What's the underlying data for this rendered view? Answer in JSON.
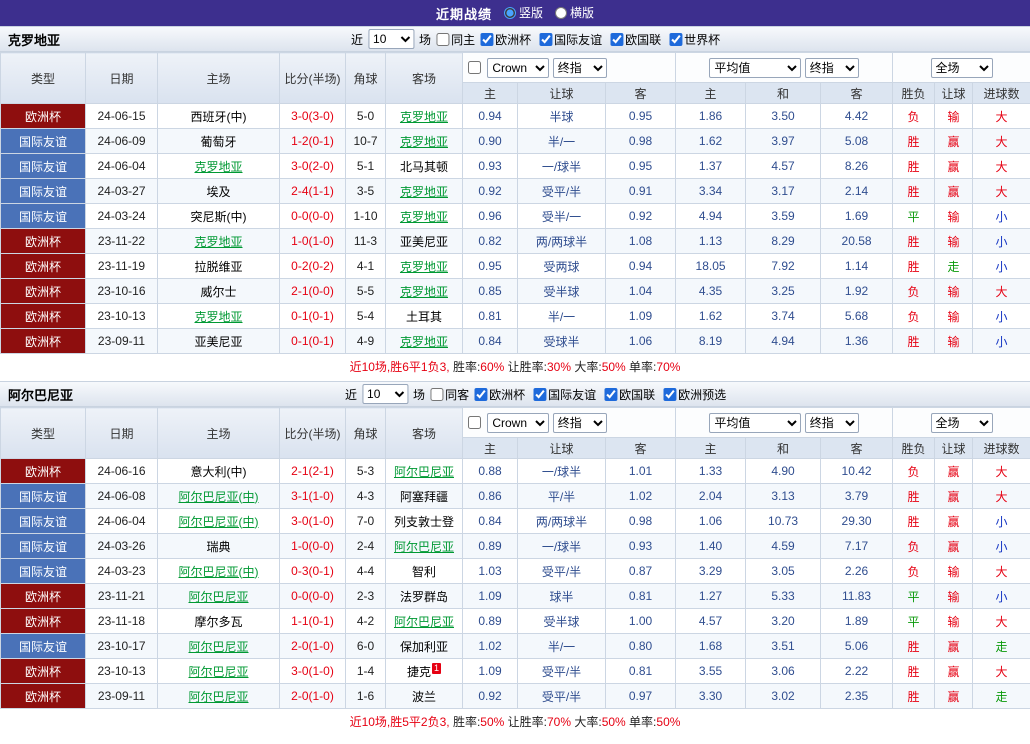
{
  "topbar": {
    "title": "近期战绩",
    "radios": [
      {
        "label": "竖版",
        "selected": true
      },
      {
        "label": "横版",
        "selected": false
      }
    ]
  },
  "colors": {
    "type_bg": {
      "欧洲杯": "#8e0e0e",
      "国际友谊": "#4a72b8"
    },
    "result_text": {
      "胜": "#e60012",
      "负": "#e60012",
      "平": "#0b9a0b",
      "赢": "#e60012",
      "输": "#e60012",
      "走": "#0b9a0b",
      "大": "#e60012",
      "小": "#1536c4"
    },
    "score": "#e60012",
    "focus_team": "#009933",
    "odds": "#2f4d8f",
    "topbar_bg": "#3d2f8e"
  },
  "table_header": {
    "type": "类型",
    "date": "日期",
    "home": "主场",
    "score": "比分(半场)",
    "corner": "角球",
    "away": "客场",
    "asian_home": "主",
    "asian_handicap": "让球",
    "asian_away": "客",
    "euro_home": "主",
    "euro_draw": "和",
    "euro_away": "客",
    "result": "胜负",
    "handicap_result": "让球",
    "goals": "进球数"
  },
  "sections": [
    {
      "team": "克罗地亚",
      "filter": {
        "near": "近",
        "count": "10",
        "unit": "场",
        "same": {
          "label": "同主",
          "checked": false
        },
        "competitions": [
          {
            "label": "欧洲杯",
            "checked": true
          },
          {
            "label": "国际友谊",
            "checked": true
          },
          {
            "label": "欧国联",
            "checked": true
          },
          {
            "label": "世界杯",
            "checked": true
          }
        ]
      },
      "selects": {
        "compare_checked": false,
        "bookmaker": "Crown",
        "bookmaker_period": "终指",
        "euro_avg": "平均值",
        "euro_period": "终指",
        "scope": "全场"
      },
      "rows": [
        {
          "type": "欧洲杯",
          "date": "24-06-15",
          "home": "西班牙(中)",
          "score": "3-0(3-0)",
          "corner": "5-0",
          "away": "克罗地亚",
          "away_focus": true,
          "ah_home": "0.94",
          "ah_line": "半球",
          "ah_away": "0.95",
          "eu_home": "1.86",
          "eu_draw": "3.50",
          "eu_away": "4.42",
          "res": "负",
          "ah_res": "输",
          "ou_res": "大"
        },
        {
          "type": "国际友谊",
          "date": "24-06-09",
          "home": "葡萄牙",
          "score": "1-2(0-1)",
          "corner": "10-7",
          "away": "克罗地亚",
          "away_focus": true,
          "ah_home": "0.90",
          "ah_line": "半/一",
          "ah_away": "0.98",
          "eu_home": "1.62",
          "eu_draw": "3.97",
          "eu_away": "5.08",
          "res": "胜",
          "ah_res": "赢",
          "ou_res": "大"
        },
        {
          "type": "国际友谊",
          "date": "24-06-04",
          "home": "克罗地亚",
          "home_focus": true,
          "score": "3-0(2-0)",
          "corner": "5-1",
          "away": "北马其顿",
          "ah_home": "0.93",
          "ah_line": "一/球半",
          "ah_away": "0.95",
          "eu_home": "1.37",
          "eu_draw": "4.57",
          "eu_away": "8.26",
          "res": "胜",
          "ah_res": "赢",
          "ou_res": "大"
        },
        {
          "type": "国际友谊",
          "date": "24-03-27",
          "home": "埃及",
          "score": "2-4(1-1)",
          "corner": "3-5",
          "away": "克罗地亚",
          "away_focus": true,
          "ah_home": "0.92",
          "ah_line": "受平/半",
          "ah_away": "0.91",
          "eu_home": "3.34",
          "eu_draw": "3.17",
          "eu_away": "2.14",
          "res": "胜",
          "ah_res": "赢",
          "ou_res": "大"
        },
        {
          "type": "国际友谊",
          "date": "24-03-24",
          "home": "突尼斯(中)",
          "score": "0-0(0-0)",
          "corner": "1-10",
          "away": "克罗地亚",
          "away_focus": true,
          "ah_home": "0.96",
          "ah_line": "受半/一",
          "ah_away": "0.92",
          "eu_home": "4.94",
          "eu_draw": "3.59",
          "eu_away": "1.69",
          "res": "平",
          "ah_res": "输",
          "ou_res": "小"
        },
        {
          "type": "欧洲杯",
          "date": "23-11-22",
          "home": "克罗地亚",
          "home_focus": true,
          "score": "1-0(1-0)",
          "corner": "11-3",
          "away": "亚美尼亚",
          "ah_home": "0.82",
          "ah_line": "两/两球半",
          "ah_away": "1.08",
          "eu_home": "1.13",
          "eu_draw": "8.29",
          "eu_away": "20.58",
          "res": "胜",
          "ah_res": "输",
          "ou_res": "小"
        },
        {
          "type": "欧洲杯",
          "date": "23-11-19",
          "home": "拉脱维亚",
          "score": "0-2(0-2)",
          "corner": "4-1",
          "away": "克罗地亚",
          "away_focus": true,
          "ah_home": "0.95",
          "ah_line": "受两球",
          "ah_away": "0.94",
          "eu_home": "18.05",
          "eu_draw": "7.92",
          "eu_away": "1.14",
          "res": "胜",
          "ah_res": "走",
          "ou_res": "小"
        },
        {
          "type": "欧洲杯",
          "date": "23-10-16",
          "home": "威尔士",
          "score": "2-1(0-0)",
          "corner": "5-5",
          "away": "克罗地亚",
          "away_focus": true,
          "ah_home": "0.85",
          "ah_line": "受半球",
          "ah_away": "1.04",
          "eu_home": "4.35",
          "eu_draw": "3.25",
          "eu_away": "1.92",
          "res": "负",
          "ah_res": "输",
          "ou_res": "大"
        },
        {
          "type": "欧洲杯",
          "date": "23-10-13",
          "home": "克罗地亚",
          "home_focus": true,
          "score": "0-1(0-1)",
          "corner": "5-4",
          "away": "土耳其",
          "ah_home": "0.81",
          "ah_line": "半/一",
          "ah_away": "1.09",
          "eu_home": "1.62",
          "eu_draw": "3.74",
          "eu_away": "5.68",
          "res": "负",
          "ah_res": "输",
          "ou_res": "小"
        },
        {
          "type": "欧洲杯",
          "date": "23-09-11",
          "home": "亚美尼亚",
          "score": "0-1(0-1)",
          "corner": "4-9",
          "away": "克罗地亚",
          "away_focus": true,
          "ah_home": "0.84",
          "ah_line": "受球半",
          "ah_away": "1.06",
          "eu_home": "8.19",
          "eu_draw": "4.94",
          "eu_away": "1.36",
          "res": "胜",
          "ah_res": "输",
          "ou_res": "小"
        }
      ],
      "summary": [
        {
          "text": "近10场,胜6平1负3, ",
          "color": "#e60012"
        },
        {
          "text": "胜率:",
          "color": "#222222"
        },
        {
          "text": "60%",
          "color": "#e60012"
        },
        {
          "text": " 让胜率:",
          "color": "#222222"
        },
        {
          "text": "30%",
          "color": "#e60012"
        },
        {
          "text": " 大率:",
          "color": "#222222"
        },
        {
          "text": "50%",
          "color": "#e60012"
        },
        {
          "text": " 单率:",
          "color": "#222222"
        },
        {
          "text": "70%",
          "color": "#e60012"
        }
      ]
    },
    {
      "team": "阿尔巴尼亚",
      "filter": {
        "near": "近",
        "count": "10",
        "unit": "场",
        "same": {
          "label": "同客",
          "checked": false
        },
        "competitions": [
          {
            "label": "欧洲杯",
            "checked": true
          },
          {
            "label": "国际友谊",
            "checked": true
          },
          {
            "label": "欧国联",
            "checked": true
          },
          {
            "label": "欧洲预选",
            "checked": true
          }
        ]
      },
      "selects": {
        "compare_checked": false,
        "bookmaker": "Crown",
        "bookmaker_period": "终指",
        "euro_avg": "平均值",
        "euro_period": "终指",
        "scope": "全场"
      },
      "rows": [
        {
          "type": "欧洲杯",
          "date": "24-06-16",
          "home": "意大利(中)",
          "score": "2-1(2-1)",
          "corner": "5-3",
          "away": "阿尔巴尼亚",
          "away_focus": true,
          "ah_home": "0.88",
          "ah_line": "一/球半",
          "ah_away": "1.01",
          "eu_home": "1.33",
          "eu_draw": "4.90",
          "eu_away": "10.42",
          "res": "负",
          "ah_res": "赢",
          "ou_res": "大"
        },
        {
          "type": "国际友谊",
          "date": "24-06-08",
          "home": "阿尔巴尼亚(中)",
          "home_focus": true,
          "score": "3-1(1-0)",
          "corner": "4-3",
          "away": "阿塞拜疆",
          "ah_home": "0.86",
          "ah_line": "平/半",
          "ah_away": "1.02",
          "eu_home": "2.04",
          "eu_draw": "3.13",
          "eu_away": "3.79",
          "res": "胜",
          "ah_res": "赢",
          "ou_res": "大"
        },
        {
          "type": "国际友谊",
          "date": "24-06-04",
          "home": "阿尔巴尼亚(中)",
          "home_focus": true,
          "score": "3-0(1-0)",
          "corner": "7-0",
          "away": "列支敦士登",
          "ah_home": "0.84",
          "ah_line": "两/两球半",
          "ah_away": "0.98",
          "eu_home": "1.06",
          "eu_draw": "10.73",
          "eu_away": "29.30",
          "res": "胜",
          "ah_res": "赢",
          "ou_res": "小"
        },
        {
          "type": "国际友谊",
          "date": "24-03-26",
          "home": "瑞典",
          "score": "1-0(0-0)",
          "corner": "2-4",
          "away": "阿尔巴尼亚",
          "away_focus": true,
          "ah_home": "0.89",
          "ah_line": "一/球半",
          "ah_away": "0.93",
          "eu_home": "1.40",
          "eu_draw": "4.59",
          "eu_away": "7.17",
          "res": "负",
          "ah_res": "赢",
          "ou_res": "小"
        },
        {
          "type": "国际友谊",
          "date": "24-03-23",
          "home": "阿尔巴尼亚(中)",
          "home_focus": true,
          "score": "0-3(0-1)",
          "corner": "4-4",
          "away": "智利",
          "ah_home": "1.03",
          "ah_line": "受平/半",
          "ah_away": "0.87",
          "eu_home": "3.29",
          "eu_draw": "3.05",
          "eu_away": "2.26",
          "res": "负",
          "ah_res": "输",
          "ou_res": "大"
        },
        {
          "type": "欧洲杯",
          "date": "23-11-21",
          "home": "阿尔巴尼亚",
          "home_focus": true,
          "score": "0-0(0-0)",
          "corner": "2-3",
          "away": "法罗群岛",
          "ah_home": "1.09",
          "ah_line": "球半",
          "ah_away": "0.81",
          "eu_home": "1.27",
          "eu_draw": "5.33",
          "eu_away": "11.83",
          "res": "平",
          "ah_res": "输",
          "ou_res": "小"
        },
        {
          "type": "欧洲杯",
          "date": "23-11-18",
          "home": "摩尔多瓦",
          "score": "1-1(0-1)",
          "corner": "4-2",
          "away": "阿尔巴尼亚",
          "away_focus": true,
          "ah_home": "0.89",
          "ah_line": "受半球",
          "ah_away": "1.00",
          "eu_home": "4.57",
          "eu_draw": "3.20",
          "eu_away": "1.89",
          "res": "平",
          "ah_res": "输",
          "ou_res": "大"
        },
        {
          "type": "国际友谊",
          "date": "23-10-17",
          "home": "阿尔巴尼亚",
          "home_focus": true,
          "score": "2-0(1-0)",
          "corner": "6-0",
          "away": "保加利亚",
          "ah_home": "1.02",
          "ah_line": "半/一",
          "ah_away": "0.80",
          "eu_home": "1.68",
          "eu_draw": "3.51",
          "eu_away": "5.06",
          "res": "胜",
          "ah_res": "赢",
          "ou_res": "走"
        },
        {
          "type": "欧洲杯",
          "date": "23-10-13",
          "home": "阿尔巴尼亚",
          "home_focus": true,
          "score": "3-0(1-0)",
          "corner": "1-4",
          "away": "捷克",
          "away_badge": "1",
          "ah_home": "1.09",
          "ah_line": "受平/半",
          "ah_away": "0.81",
          "eu_home": "3.55",
          "eu_draw": "3.06",
          "eu_away": "2.22",
          "res": "胜",
          "ah_res": "赢",
          "ou_res": "大"
        },
        {
          "type": "欧洲杯",
          "date": "23-09-11",
          "home": "阿尔巴尼亚",
          "home_focus": true,
          "score": "2-0(1-0)",
          "corner": "1-6",
          "away": "波兰",
          "ah_home": "0.92",
          "ah_line": "受平/半",
          "ah_away": "0.97",
          "eu_home": "3.30",
          "eu_draw": "3.02",
          "eu_away": "2.35",
          "res": "胜",
          "ah_res": "赢",
          "ou_res": "走"
        }
      ],
      "summary": [
        {
          "text": "近10场,胜5平2负3, ",
          "color": "#e60012"
        },
        {
          "text": "胜率:",
          "color": "#222222"
        },
        {
          "text": "50%",
          "color": "#e60012"
        },
        {
          "text": " 让胜率:",
          "color": "#222222"
        },
        {
          "text": "70%",
          "color": "#e60012"
        },
        {
          "text": " 大率:",
          "color": "#222222"
        },
        {
          "text": "50%",
          "color": "#e60012"
        },
        {
          "text": " 单率:",
          "color": "#222222"
        },
        {
          "text": "50%",
          "color": "#e60012"
        }
      ]
    }
  ]
}
